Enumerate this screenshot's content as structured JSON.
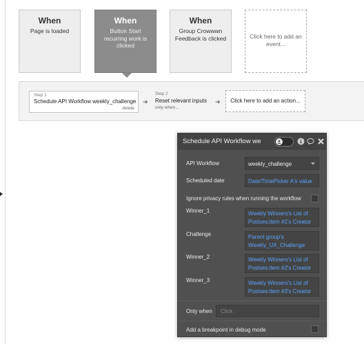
{
  "events": [
    {
      "when": "When",
      "text": "Page is loaded",
      "state": "default"
    },
    {
      "when": "When",
      "text": "Button Start recurring work is clicked",
      "state": "selected"
    },
    {
      "when": "When",
      "text": "Group Crowwwn Feedback is clicked",
      "state": "default"
    },
    {
      "when": "",
      "text": "Click here to add an event...",
      "state": "add"
    }
  ],
  "workflow": {
    "step1": {
      "label": "Step 1",
      "title": "Schedule API Workflow weekly_challenge",
      "delete": "delete"
    },
    "step2": {
      "label": "Step 2",
      "title": "Reset relevant inputs",
      "sub": "only when..."
    },
    "add_action": "Click here to add an action...",
    "arrow_icon": "arrow-right-icon"
  },
  "panel": {
    "title": "Schedule API Workflow weekly_challenge",
    "api_workflow_label": "API Workflow",
    "api_workflow_value": "weekly_challenge",
    "scheduled_date_label": "Scheduled date",
    "scheduled_date_value": "Date/TimePicker A's value",
    "ignore_privacy_label": "Ignore privacy rules when running the workflow",
    "params": [
      {
        "label": "Winner_1",
        "value": "Weekly Winners's List of Postses:item #1's Creator"
      },
      {
        "label": "Challenge",
        "value": "Parent group's Weekly_UX_Challenge"
      },
      {
        "label": "Winner_2",
        "value": "Weekly Winners's List of Postses:item #2's Creator"
      },
      {
        "label": "Winner_3",
        "value": "Weekly Winners's List of Postses:item #3's Creator"
      }
    ],
    "only_when_label": "Only when",
    "only_when_placeholder": "Click",
    "breakpoint_label": "Add a breakpoint in debug mode"
  },
  "colors": {
    "dynamic_expression": "#5aa3ff",
    "panel_bg": "#505050",
    "selected_event": "#8c8c8c"
  }
}
